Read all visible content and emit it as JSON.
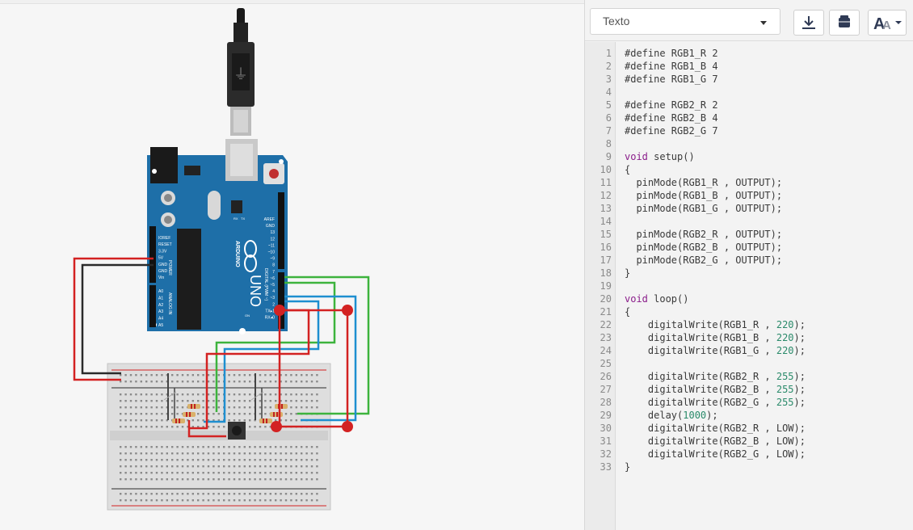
{
  "panel": {
    "mode_label": "Texto",
    "download_icon": "download-icon",
    "library_icon": "components-library-icon",
    "font_icon": "font-size-icon"
  },
  "board": {
    "model_text": "UNO",
    "brand_text": "ARDUINO",
    "power_label": "POWER",
    "analog_label": "ANALOG IN",
    "digital_label": "DIGITAL (PWM ~)",
    "tx_label": "TX",
    "rx_label": "RX",
    "on_label": "ON",
    "power_pins": [
      "IOREF",
      "RESET",
      "3.3V",
      "5V",
      "GND",
      "GND",
      "Vin"
    ],
    "analog_pins": [
      "A0",
      "A1",
      "A2",
      "A3",
      "A4",
      "A5"
    ],
    "digital_pins": [
      "AREF",
      "GND",
      "13",
      "12",
      "~11",
      "~10",
      "~9",
      "8",
      "7",
      "~6",
      "~5",
      "4",
      "~3",
      "2",
      "TX▸1",
      "RX◂0"
    ]
  },
  "colors": {
    "board": "#1e6fa8",
    "wire_red": "#d32222",
    "wire_green": "#3db33d",
    "wire_blue": "#1e8fd0",
    "wire_black": "#2a2a2a"
  },
  "code": {
    "lines": [
      "#define RGB1_R 2",
      "#define RGB1_B 4",
      "#define RGB1_G 7",
      "",
      "#define RGB2_R 2",
      "#define RGB2_B 4",
      "#define RGB2_G 7",
      "",
      "void setup()",
      "{",
      "  pinMode(RGB1_R , OUTPUT);",
      "  pinMode(RGB1_B , OUTPUT);",
      "  pinMode(RGB1_G , OUTPUT);",
      "",
      "  pinMode(RGB2_R , OUTPUT);",
      "  pinMode(RGB2_B , OUTPUT);",
      "  pinMode(RGB2_G , OUTPUT);",
      "}",
      "",
      "void loop()",
      "{",
      "    digitalWrite(RGB1_R , 220);",
      "    digitalWrite(RGB1_B , 220);",
      "    digitalWrite(RGB1_G , 220);",
      "",
      "    digitalWrite(RGB2_R , 255);",
      "    digitalWrite(RGB2_B , 255);",
      "    digitalWrite(RGB2_G , 255);",
      "    delay(1000);",
      "    digitalWrite(RGB2_R , LOW);",
      "    digitalWrite(RGB2_B , LOW);",
      "    digitalWrite(RGB2_G , LOW);",
      "}"
    ]
  }
}
